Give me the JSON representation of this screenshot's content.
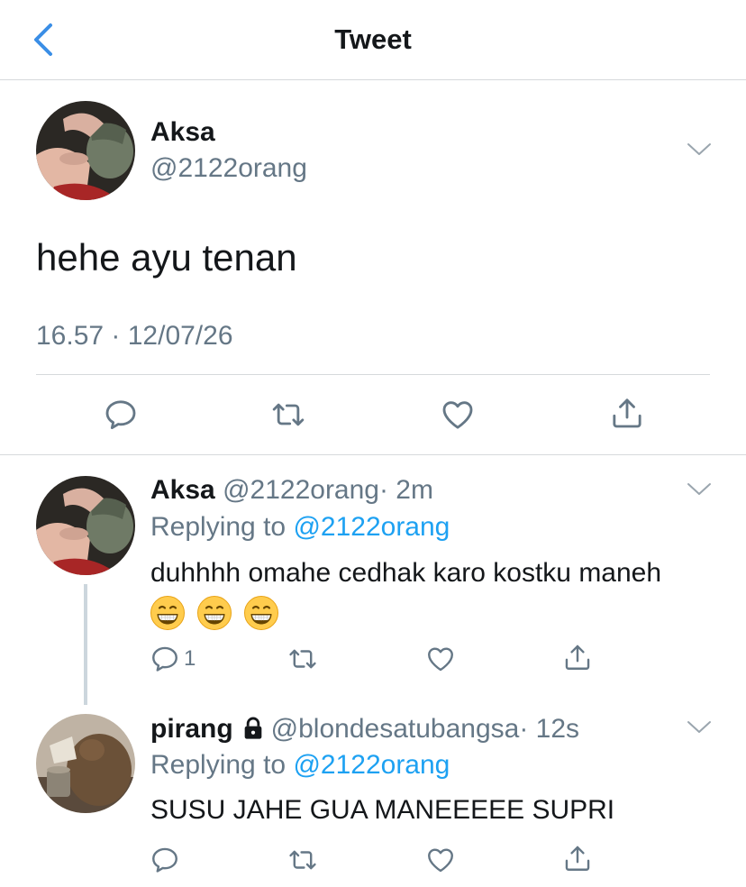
{
  "header": {
    "title": "Tweet",
    "back_icon": "chevron-left-icon"
  },
  "colors": {
    "accent": "#1da1f2",
    "back": "#3a8ee6",
    "muted": "#657786",
    "text": "#14171a",
    "divider": "#d6d9dc"
  },
  "main_tweet": {
    "name": "Aksa",
    "handle": "@2122orang",
    "text": "hehe ayu tenan",
    "timestamp": "16.57 · 12/07/26",
    "actions": [
      "reply-icon",
      "retweet-icon",
      "like-icon",
      "share-icon"
    ]
  },
  "replies": [
    {
      "name": "Aksa",
      "handle": "@2122orang",
      "time": "· 2m",
      "replying_prefix": "Replying to ",
      "replying_to": "@2122orang",
      "text": "duhhhh omahe cedhak karo kostku maneh",
      "emojis": [
        "grinning-face-icon",
        "grinning-face-icon",
        "grinning-face-icon"
      ],
      "reply_count": "1"
    },
    {
      "name": "pirang",
      "locked": true,
      "handle": "@blondesatubangsa",
      "time": "· 12s",
      "replying_prefix": "Replying to ",
      "replying_to": "@2122orang",
      "text": "SUSU JAHE GUA MANEEEEE SUPRI"
    }
  ]
}
